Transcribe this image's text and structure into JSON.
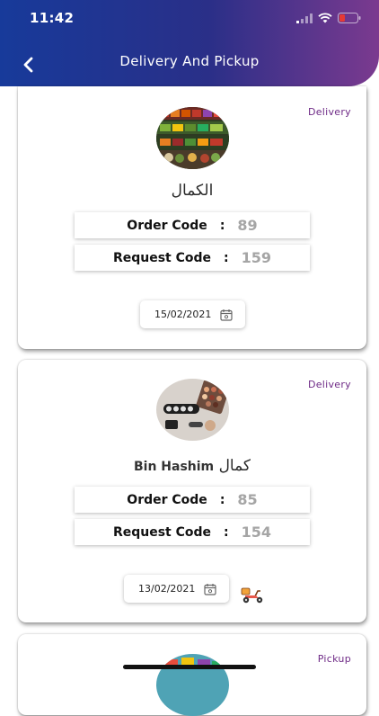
{
  "status": {
    "time": "11:42"
  },
  "header": {
    "title": "Delivery And Pickup"
  },
  "orders": [
    {
      "type": "Delivery",
      "shop_name_urdu": "الکمال",
      "shop_name_latin": "",
      "order_code_label": "Order Code",
      "order_code": "89",
      "request_code_label": "Request Code",
      "request_code": "159",
      "date": "15/02/2021",
      "image_icon": "grocery-shelves-image"
    },
    {
      "type": "Delivery",
      "shop_name_urdu": "کمال",
      "shop_name_latin": "Bin Hashim",
      "order_code_label": "Order Code",
      "order_code": "85",
      "request_code_label": "Request Code",
      "request_code": "154",
      "date": "13/02/2021",
      "image_icon": "cosmetics-image",
      "extra_icon": "delivery-scooter-icon"
    },
    {
      "type": "Pickup",
      "image_icon": "shop-image"
    }
  ],
  "colors": {
    "header_gradient_start": "#173a9a",
    "header_gradient_end": "#7b3a8f",
    "badge": "#6e2a86",
    "code_value": "#a5a5a5"
  }
}
